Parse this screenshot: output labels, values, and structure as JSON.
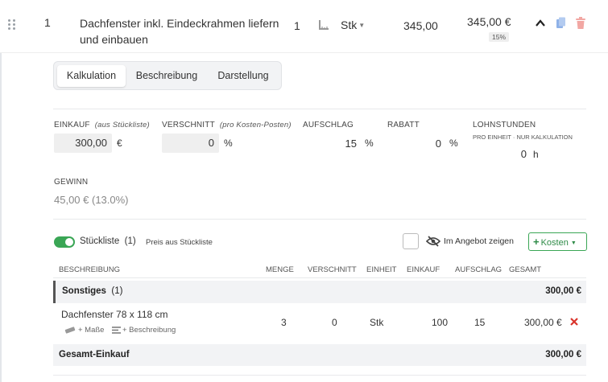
{
  "position": {
    "number": "1",
    "title_line1": "Dachfenster inkl. Eindeckrahmen liefern",
    "title_line2": "und einbauen",
    "quantity": "1",
    "unit": "Stk",
    "unit_price": "345,00",
    "total": "345,00 €",
    "badge": "15%"
  },
  "tabs": [
    {
      "label": "Kalkulation",
      "active": true
    },
    {
      "label": "Beschreibung",
      "active": false
    },
    {
      "label": "Darstellung",
      "active": false
    }
  ],
  "calc": {
    "einkauf_label": "EINKAUF",
    "einkauf_hint": "(aus Stückliste)",
    "einkauf_value": "300,00",
    "einkauf_unit": "€",
    "verschnitt_label": "VERSCHNITT",
    "verschnitt_hint": "(pro Kosten-Posten)",
    "verschnitt_value": "0",
    "verschnitt_unit": "%",
    "aufschlag_label": "AUFSCHLAG",
    "aufschlag_value": "15",
    "aufschlag_unit": "%",
    "rabatt_label": "RABATT",
    "rabatt_value": "0",
    "rabatt_unit": "%",
    "lohn_label": "LOHNSTUNDEN",
    "lohn_hint": "PRO EINHEIT · NUR KALKULATION",
    "lohn_value": "0",
    "lohn_unit": "h",
    "gewinn_label": "GEWINN",
    "gewinn_value": "45,00 € (13.0%)"
  },
  "stueckliste": {
    "label": "Stückliste",
    "count": "(1)",
    "price_hint": "Preis aus Stückliste",
    "show_in_offer": "Im Angebot zeigen",
    "costs_button": "Kosten"
  },
  "table": {
    "headers": [
      "BESCHREIBUNG",
      "MENGE",
      "VERSCHNITT",
      "EINHEIT",
      "EINKAUF",
      "AUFSCHLAG",
      "GESAMT"
    ],
    "group": {
      "name": "Sonstiges",
      "count": "(1)",
      "total": "300,00 €"
    },
    "row": {
      "description": "Dachfenster 78 x 118 cm",
      "menge": "3",
      "verschnitt": "0",
      "einheit": "Stk",
      "einkauf": "100",
      "aufschlag": "15",
      "gesamt": "300,00 €",
      "add_masse": "+ Maße",
      "add_beschreibung": "+ Beschreibung"
    },
    "total_label": "Gesamt-Einkauf",
    "total_value": "300,00 €"
  },
  "colors": {
    "accent_green": "#3aa655",
    "delete_red": "#d9342b",
    "copy_blue": "#8fb2e8"
  }
}
